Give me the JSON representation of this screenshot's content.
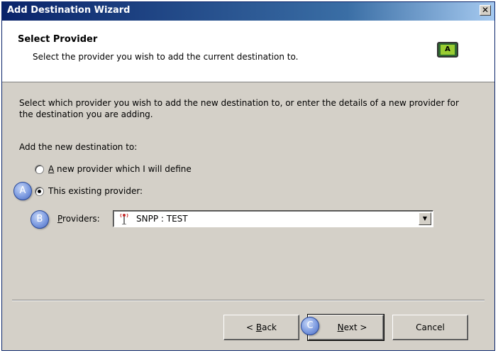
{
  "window": {
    "title": "Add Destination Wizard",
    "close_glyph": "✕"
  },
  "header": {
    "title": "Select Provider",
    "subtitle": "Select the provider you wish to add the current destination to.",
    "icon_text": "A",
    "icon": "wizard-icon"
  },
  "body": {
    "description": "Select which provider you wish to add the new destination to, or enter the details of a new provider for the destination you are adding.",
    "add_label": "Add the new destination to:",
    "options": [
      {
        "label_access": "A",
        "label_rest": " new provider which I will define",
        "checked": false
      },
      {
        "label_access": "",
        "label_rest": "This existing provider:",
        "checked": true
      }
    ],
    "providers_label_access": "P",
    "providers_label_rest": "roviders:",
    "providers_value": "SNPP : TEST",
    "providers_icon": "antenna-icon"
  },
  "callouts": {
    "a": "A",
    "b": "B",
    "c": "C"
  },
  "buttons": {
    "back_access": "<",
    "back_pre": " ",
    "back_u": "B",
    "back_rest": "ack",
    "next_u": "N",
    "next_rest": "ext >",
    "cancel": "Cancel"
  },
  "colors": {
    "titlebar": "#0a246a",
    "dialog_bg": "#d4d0c8",
    "callout": "#7d9be0"
  }
}
